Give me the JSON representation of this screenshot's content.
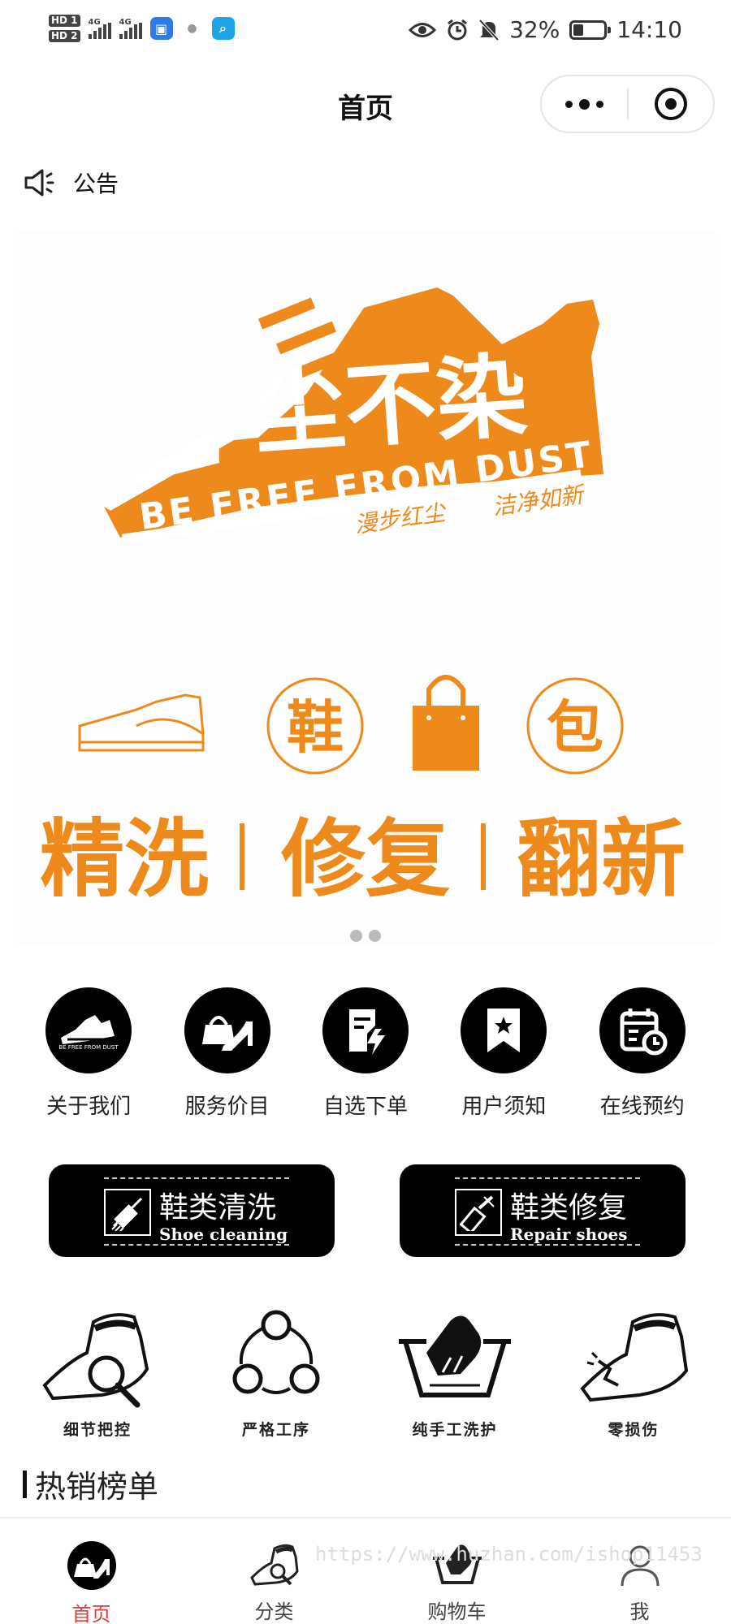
{
  "status_bar": {
    "hd1": "HD 1",
    "hd2": "HD 2",
    "network1": "4G",
    "network2": "4G",
    "battery_percent": "32%",
    "battery_level": 0.32,
    "time": "14:10"
  },
  "title_bar": {
    "title": "首页"
  },
  "notice": {
    "label": "公告"
  },
  "banner": {
    "brand_cn": "尘不染",
    "brand_en": "BE FREE FROM DUST",
    "slogan_left": "漫步红尘",
    "slogan_right": "洁净如新",
    "badge_shoe": "鞋",
    "badge_bag": "包",
    "service_1": "精洗",
    "service_2": "修复",
    "service_3": "翻新",
    "accent_color": "#ee8a1c",
    "slide_count": 2
  },
  "quick_menu": [
    {
      "label": "关于我们",
      "icon": "brand-logo-icon"
    },
    {
      "label": "服务价目",
      "icon": "handbag-heel-icon"
    },
    {
      "label": "自选下单",
      "icon": "order-form-icon"
    },
    {
      "label": "用户须知",
      "icon": "bookmark-star-icon"
    },
    {
      "label": "在线预约",
      "icon": "calendar-clock-icon"
    }
  ],
  "service_buttons": [
    {
      "cn": "鞋类清洗",
      "en": "Shoe cleaning",
      "icon": "brush-icon"
    },
    {
      "cn": "鞋类修复",
      "en": "Repair shoes",
      "icon": "glue-bottle-icon"
    }
  ],
  "features": [
    {
      "label": "细节把控",
      "icon": "shoe-magnifier-icon"
    },
    {
      "label": "严格工序",
      "icon": "process-cycle-icon"
    },
    {
      "label": "纯手工洗护",
      "icon": "hand-wash-icon"
    },
    {
      "label": "零损伤",
      "icon": "shoe-repair-icon"
    }
  ],
  "hot_section": {
    "title": "热销榜单"
  },
  "tab_bar": [
    {
      "label": "首页",
      "icon": "home-shoe-icon",
      "active": true
    },
    {
      "label": "分类",
      "icon": "category-shoe-icon",
      "active": false
    },
    {
      "label": "购物车",
      "icon": "cart-basin-icon",
      "active": false
    },
    {
      "label": "我",
      "icon": "user-icon",
      "active": false
    }
  ],
  "watermark": "https://www.huzhan.com/ishop11453",
  "colors": {
    "active_tab": "#e03b3b",
    "brand_orange": "#ee8a1c"
  }
}
